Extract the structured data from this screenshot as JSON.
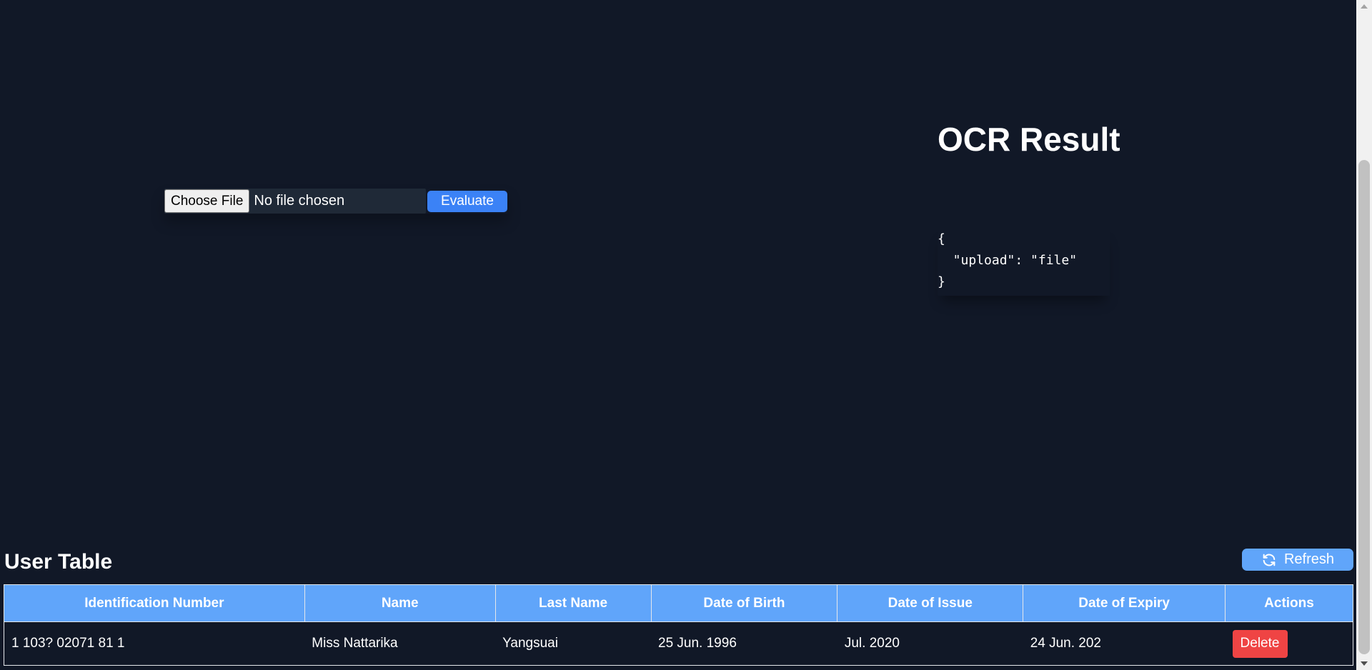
{
  "upload": {
    "choose_label": "Choose File",
    "no_file_text": "No file chosen",
    "evaluate_label": "Evaluate"
  },
  "ocr": {
    "title": "OCR Result",
    "json_text": "{\n  \"upload\": \"file\"\n}"
  },
  "user_table": {
    "title": "User Table",
    "refresh_label": "Refresh",
    "headers": [
      "Identification Number",
      "Name",
      "Last Name",
      "Date of Birth",
      "Date of Issue",
      "Date of Expiry",
      "Actions"
    ],
    "rows": [
      {
        "id_number": "1 103? 02071 81 1",
        "name": "Miss Nattarika",
        "last_name": "Yangsuai",
        "dob": "25 Jun. 1996",
        "issue": "Jul. 2020",
        "expiry": "24 Jun. 202",
        "action_label": "Delete"
      }
    ]
  },
  "colors": {
    "background": "#111827",
    "accent": "#3b82f6",
    "header_blue": "#60a5fa",
    "danger": "#ef4444"
  },
  "icons": {
    "refresh": "refresh-icon"
  }
}
